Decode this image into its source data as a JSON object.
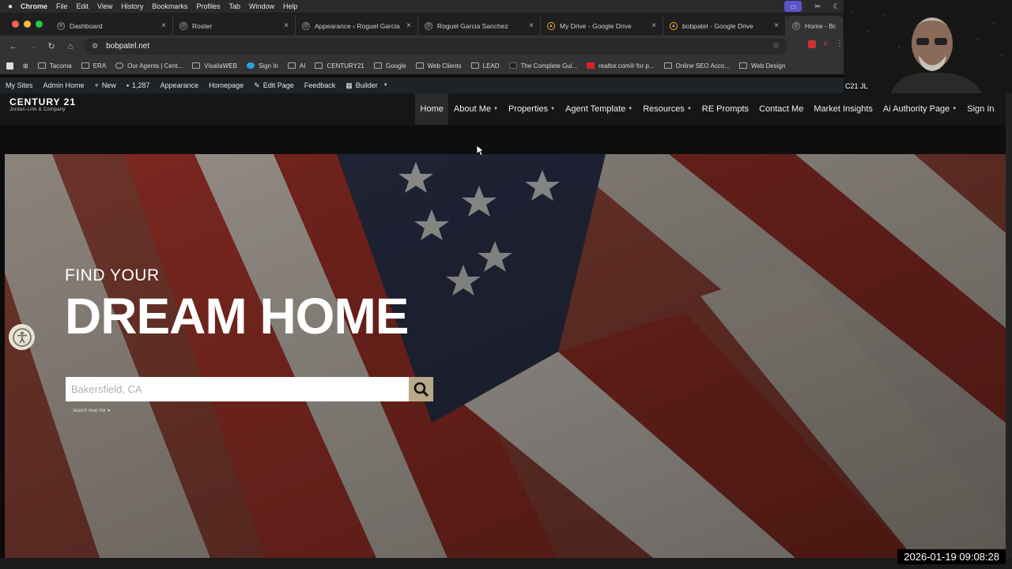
{
  "mac_menu": {
    "app": "Chrome",
    "items": [
      "File",
      "Edit",
      "View",
      "History",
      "Bookmarks",
      "Profiles",
      "Tab",
      "Window",
      "Help"
    ]
  },
  "tabs": [
    {
      "title": "Dashboard"
    },
    {
      "title": "Roster"
    },
    {
      "title": "Appearance ‹ Roguel Garcia"
    },
    {
      "title": "Roguel Garcia Sanchez"
    },
    {
      "title": "My Drive - Google Drive"
    },
    {
      "title": "bobpatel - Google Drive"
    },
    {
      "title": "Home - Bob P"
    }
  ],
  "address": {
    "url": "bobpatel.net"
  },
  "bookmarks": [
    "Tacoma",
    "ERA",
    "Our Agents | Cent...",
    "VisaliaWEB",
    "Sign In",
    "AI",
    "CENTURY21",
    "Google",
    "Web Clients",
    "LEAD",
    "The Complete Gui...",
    "realtor.com® for p...",
    "Online SEO Acco...",
    "Web Design"
  ],
  "wp_admin": {
    "my_sites": "My Sites",
    "admin_home": "Admin Home",
    "new": "New",
    "comments": "1,287",
    "appearance": "Appearance",
    "homepage": "Homepage",
    "edit_page": "Edit Page",
    "feedback": "Feedback",
    "builder": "Builder"
  },
  "site": {
    "logo_main": "CENTURY 21",
    "logo_sub": "Jordan-Link & Company",
    "nav": [
      {
        "label": "Home",
        "active": true,
        "dropdown": false
      },
      {
        "label": "About Me",
        "dropdown": true
      },
      {
        "label": "Properties",
        "dropdown": true
      },
      {
        "label": "Agent Template",
        "dropdown": true
      },
      {
        "label": "Resources",
        "dropdown": true
      },
      {
        "label": "RE Prompts",
        "dropdown": false
      },
      {
        "label": "Contact Me",
        "dropdown": false
      },
      {
        "label": "Market Insights",
        "dropdown": false
      },
      {
        "label": "Ai Authority Page",
        "dropdown": true
      },
      {
        "label": "Sign In",
        "dropdown": false
      }
    ],
    "hero": {
      "line1": "FIND YOUR",
      "line2": "DREAM HOME",
      "search_placeholder": "Bakersfield, CA",
      "near_me": "search near me"
    }
  },
  "webcam_label": "C21 JL",
  "timestamp": "2026-01-19  09:08:28",
  "colors": {
    "search_button": "#b8a98a",
    "nav_bg": "#161616",
    "wp_bar": "#1d2327"
  }
}
